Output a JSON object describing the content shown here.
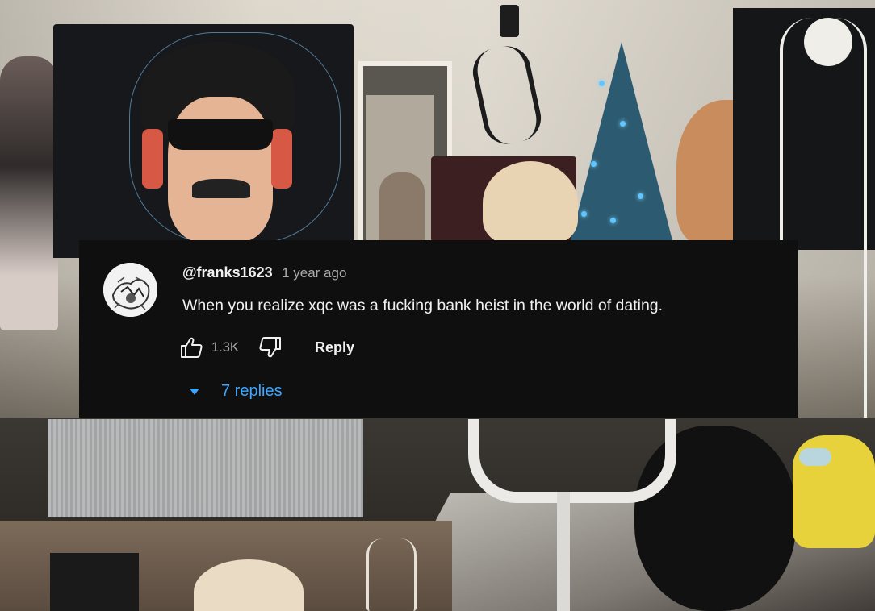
{
  "comment": {
    "author_handle": "@franks1623",
    "timestamp": "1 year ago",
    "text": "When you realize xqc was a fucking bank heist in the world of dating.",
    "like_count": "1.3K",
    "reply_label": "Reply",
    "replies_label": "7 replies"
  },
  "icons": {
    "like": "thumbs-up-icon",
    "dislike": "thumbs-down-icon",
    "expand": "caret-down-icon"
  },
  "colors": {
    "card_background": "#0f0f0f",
    "primary_text": "#f1f1f1",
    "secondary_text": "#aaaaaa",
    "link_blue": "#3ea6ff"
  }
}
